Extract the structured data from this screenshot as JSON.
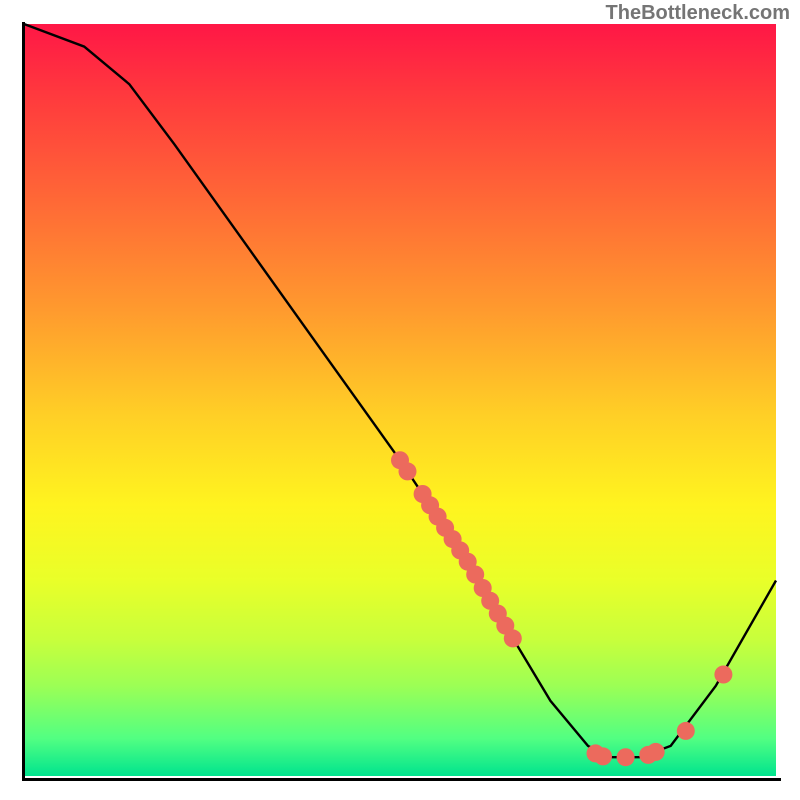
{
  "attribution": "TheBottleneck.com",
  "chart_data": {
    "type": "line",
    "title": "",
    "xlabel": "",
    "ylabel": "",
    "xlim": [
      0,
      100
    ],
    "ylim": [
      0,
      100
    ],
    "curve": [
      {
        "x": 0,
        "y": 100
      },
      {
        "x": 8,
        "y": 97
      },
      {
        "x": 14,
        "y": 92
      },
      {
        "x": 20,
        "y": 84
      },
      {
        "x": 30,
        "y": 70
      },
      {
        "x": 40,
        "y": 56
      },
      {
        "x": 50,
        "y": 42
      },
      {
        "x": 58,
        "y": 30
      },
      {
        "x": 64,
        "y": 20
      },
      {
        "x": 70,
        "y": 10
      },
      {
        "x": 75,
        "y": 4
      },
      {
        "x": 78,
        "y": 2.5
      },
      {
        "x": 82,
        "y": 2.5
      },
      {
        "x": 86,
        "y": 4
      },
      {
        "x": 92,
        "y": 12
      },
      {
        "x": 100,
        "y": 26
      }
    ],
    "points": [
      {
        "x": 50,
        "y": 42
      },
      {
        "x": 51,
        "y": 40.5
      },
      {
        "x": 53,
        "y": 37.5
      },
      {
        "x": 54,
        "y": 36
      },
      {
        "x": 55,
        "y": 34.5
      },
      {
        "x": 56,
        "y": 33
      },
      {
        "x": 57,
        "y": 31.5
      },
      {
        "x": 58,
        "y": 30
      },
      {
        "x": 59,
        "y": 28.5
      },
      {
        "x": 60,
        "y": 26.8
      },
      {
        "x": 61,
        "y": 25
      },
      {
        "x": 62,
        "y": 23.3
      },
      {
        "x": 63,
        "y": 21.6
      },
      {
        "x": 64,
        "y": 20
      },
      {
        "x": 65,
        "y": 18.3
      },
      {
        "x": 76,
        "y": 3
      },
      {
        "x": 77,
        "y": 2.6
      },
      {
        "x": 80,
        "y": 2.5
      },
      {
        "x": 83,
        "y": 2.8
      },
      {
        "x": 84,
        "y": 3.2
      },
      {
        "x": 88,
        "y": 6
      },
      {
        "x": 93,
        "y": 13.5
      }
    ],
    "colors": {
      "curve": "#000000",
      "points": "#ec6a5d",
      "gradient_top": "#ff1746",
      "gradient_bottom": "#00e48e"
    }
  }
}
